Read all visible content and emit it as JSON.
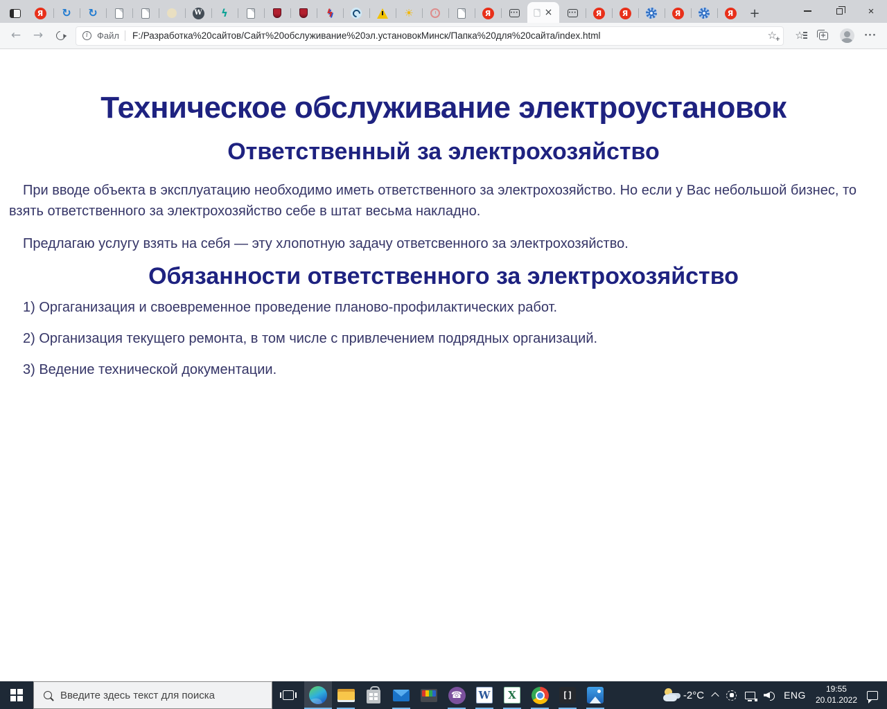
{
  "browser": {
    "tab_bar": {
      "tabs": [
        {
          "icon": "yandex-icon"
        },
        {
          "icon": "sync-icon"
        },
        {
          "icon": "sync-icon"
        },
        {
          "icon": "page-icon"
        },
        {
          "icon": "page-icon"
        },
        {
          "icon": "loading-tab-icon"
        },
        {
          "icon": "wordpress-icon"
        },
        {
          "icon": "lightning-teal-icon"
        },
        {
          "icon": "page-icon"
        },
        {
          "icon": "emblem-icon"
        },
        {
          "icon": "emblem-icon"
        },
        {
          "icon": "lightning-redblue-icon"
        },
        {
          "icon": "plug-icon"
        },
        {
          "icon": "warning-icon"
        },
        {
          "icon": "sun-icon"
        },
        {
          "icon": "clock-icon"
        },
        {
          "icon": "page-icon"
        },
        {
          "icon": "yandex-icon"
        },
        {
          "icon": "card-tab-icon"
        },
        {
          "icon": "page-icon",
          "active": true
        },
        {
          "icon": "card-tab-icon"
        },
        {
          "icon": "yandex-icon"
        },
        {
          "icon": "yandex-icon"
        },
        {
          "icon": "helm-icon"
        },
        {
          "icon": "yandex-icon"
        },
        {
          "icon": "helm-icon"
        },
        {
          "icon": "yandex-icon"
        }
      ]
    },
    "toolbar": {
      "scheme_label": "Файл",
      "url": "F:/Разработка%20сайтов/Сайт%20обслуживание%20эл.установокМинск/Папка%20для%20сайта/index.html"
    }
  },
  "page": {
    "title": "Техническое обслуживание электроустановок",
    "subtitle": "Ответственный за электрохозяйство",
    "paragraph1": "При вводе объекта в эксплуатацию необходимо иметь ответственного за электрохозяйство. Но если у Вас небольшой бизнес, то взять ответственного за электрохозяйство себе в штат весьма накладно.",
    "paragraph2": "Предлагаю услугу взять на себя — эту хлопотную задачу ответсвенного за электрохозяйство.",
    "duties_title": "Обязанности ответственного за электрохозяйство",
    "duties": [
      "1) Оргаганизация и своевременное проведение планово-профилактических работ.",
      "2) Организация текущего ремонта, в том числе с привлечением подрядных организаций.",
      "3) Ведение технической документации."
    ]
  },
  "taskbar": {
    "search_placeholder": "Введите здесь текст для поиска",
    "apps": [
      {
        "icon": "edge-icon",
        "active": true,
        "running": true
      },
      {
        "icon": "explorer-icon",
        "running": true
      },
      {
        "icon": "store-icon",
        "running": false
      },
      {
        "icon": "mail-icon",
        "running": true
      },
      {
        "icon": "toolbox-icon",
        "running": false
      },
      {
        "icon": "viber-icon",
        "running": true
      },
      {
        "icon": "word-icon",
        "running": true
      },
      {
        "icon": "excel-icon",
        "running": true
      },
      {
        "icon": "chrome-icon",
        "running": true
      },
      {
        "icon": "brackets-icon",
        "running": true
      },
      {
        "icon": "photos-icon",
        "running": true
      }
    ],
    "tray": {
      "temperature": "-2°C",
      "language": "ENG",
      "time": "19:55",
      "date": "20.01.2022"
    }
  },
  "colors": {
    "taskbar_bg": "#1e2936",
    "running_underline": "#76b9ed",
    "heading_text": "#1e2280",
    "body_text": "#353567"
  }
}
